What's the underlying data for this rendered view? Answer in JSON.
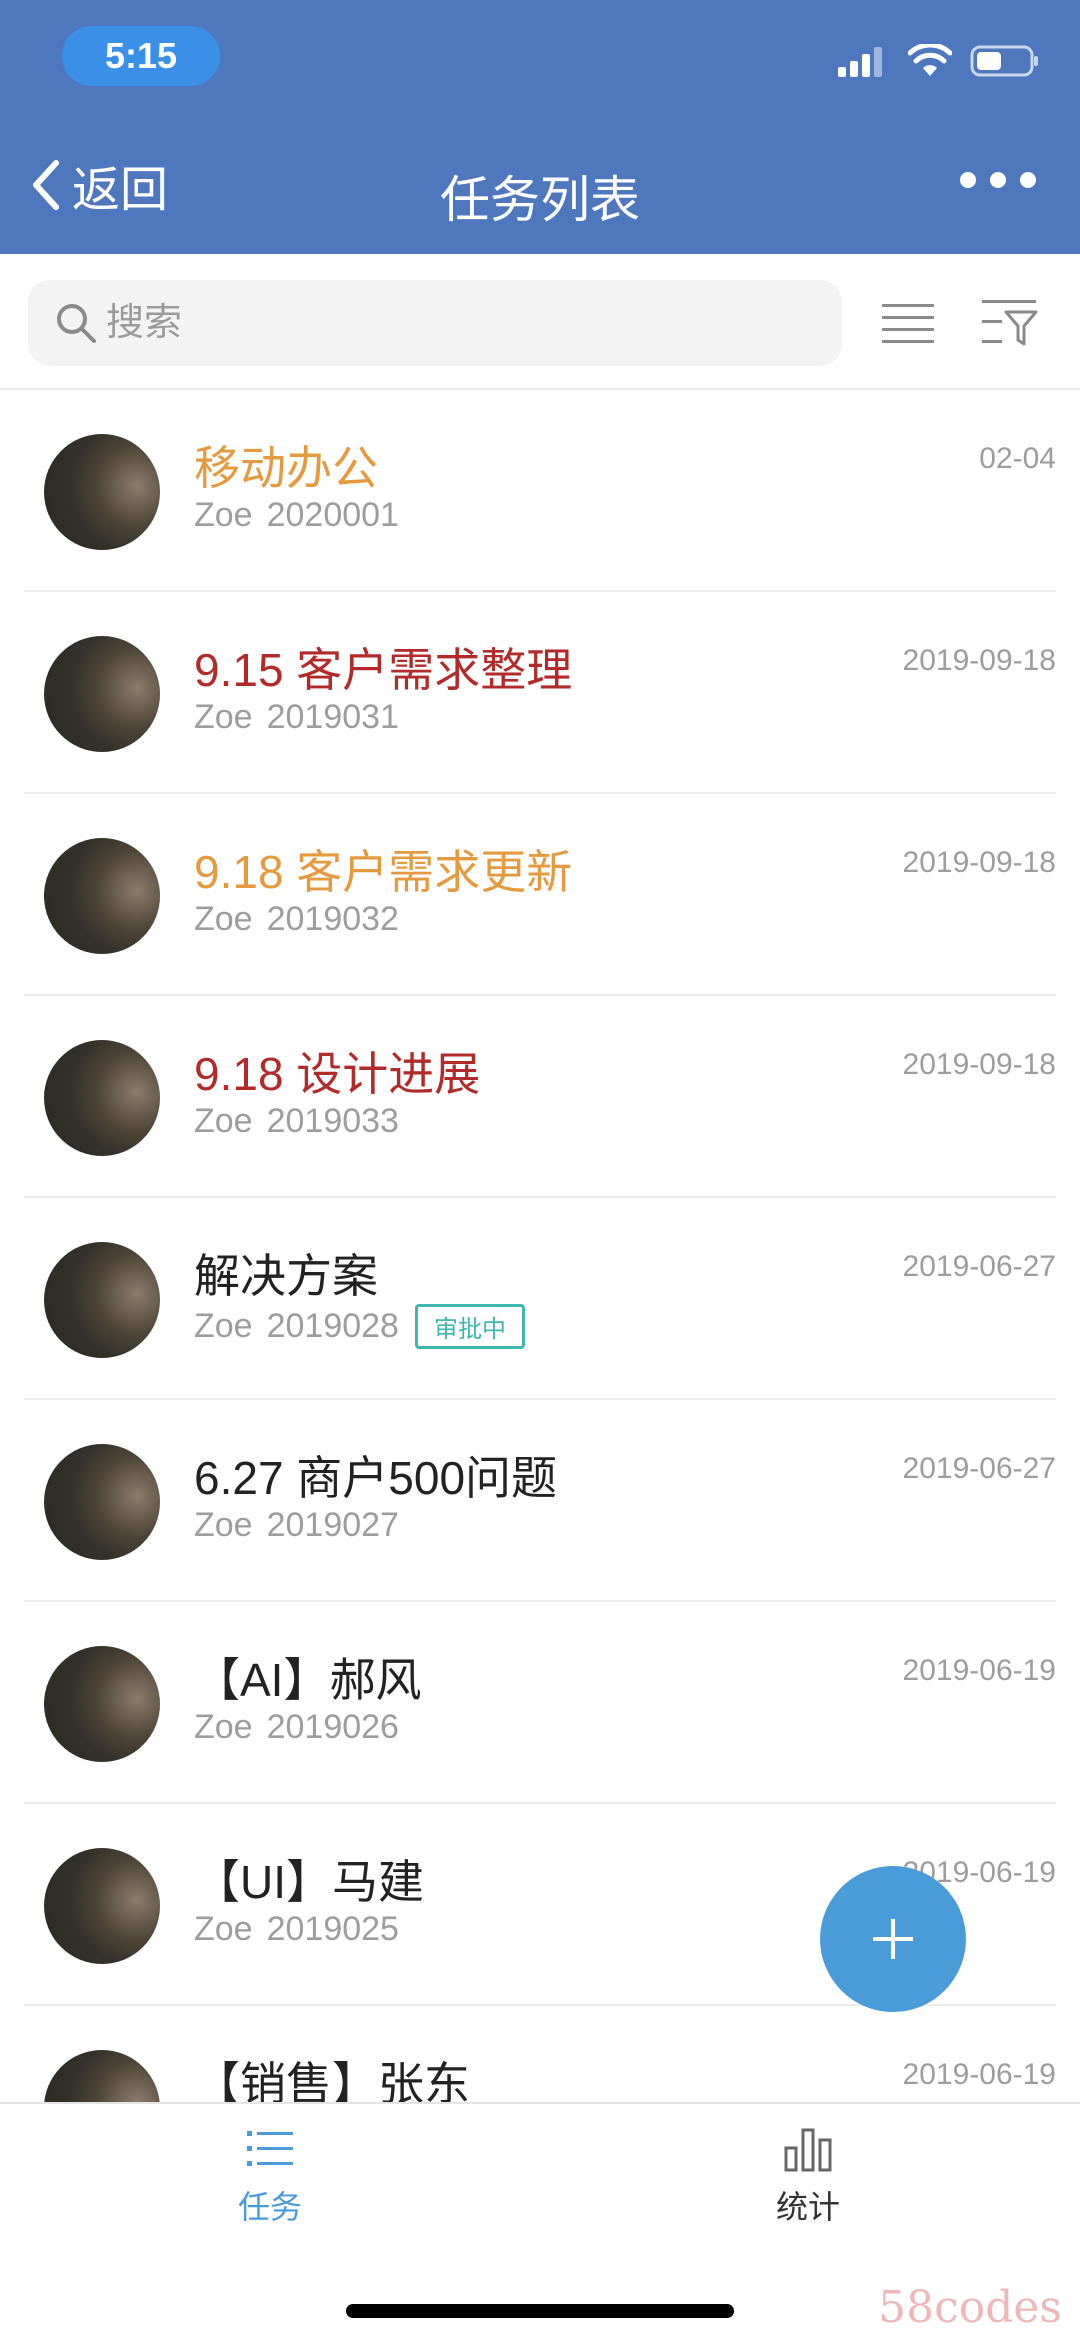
{
  "status_bar": {
    "time": "5:15"
  },
  "nav": {
    "back_label": "返回",
    "title": "任务列表"
  },
  "search": {
    "placeholder": "搜索"
  },
  "tasks": [
    {
      "title": "移动办公",
      "user": "Zoe",
      "code": "2020001",
      "date": "02-04",
      "title_color": "#e59a3f"
    },
    {
      "title": "9.15 客户需求整理",
      "user": "Zoe",
      "code": "2019031",
      "date": "2019-09-18",
      "title_color": "#b22b2b"
    },
    {
      "title": "9.18 客户需求更新",
      "user": "Zoe",
      "code": "2019032",
      "date": "2019-09-18",
      "title_color": "#e59a3f"
    },
    {
      "title": "9.18 设计进展",
      "user": "Zoe",
      "code": "2019033",
      "date": "2019-09-18",
      "title_color": "#b22b2b"
    },
    {
      "title": "解决方案",
      "user": "Zoe",
      "code": "2019028",
      "date": "2019-06-27",
      "title_color": "#222222",
      "badge": "审批中"
    },
    {
      "title": "6.27 商户500问题",
      "user": "Zoe",
      "code": "2019027",
      "date": "2019-06-27",
      "title_color": "#222222"
    },
    {
      "title": "【AI】郝风",
      "user": "Zoe",
      "code": "2019026",
      "date": "2019-06-19",
      "title_color": "#222222"
    },
    {
      "title": "【UI】马建",
      "user": "Zoe",
      "code": "2019025",
      "date": "2019-06-19",
      "title_color": "#222222"
    },
    {
      "title": "【销售】张东",
      "user": "",
      "code": "",
      "date": "2019-06-19",
      "title_color": "#222222"
    }
  ],
  "tabbar": {
    "tasks_label": "任务",
    "stats_label": "统计"
  },
  "watermark": "58codes",
  "colors": {
    "header": "#4e77bd",
    "accent": "#4a9cd8",
    "badge": "#3fb7b0"
  }
}
